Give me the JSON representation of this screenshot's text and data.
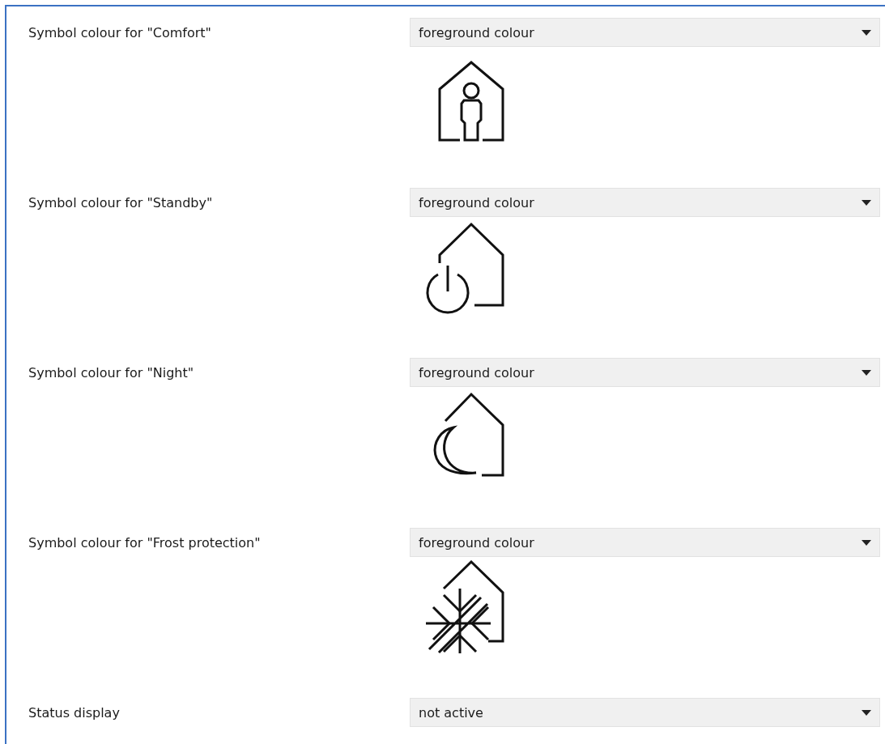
{
  "settings": [
    {
      "label": "Symbol colour for \"Comfort\"",
      "value": "foreground colour",
      "kind": "comfort"
    },
    {
      "label": "Symbol colour for \"Standby\"",
      "value": "foreground colour",
      "kind": "standby"
    },
    {
      "label": "Symbol colour for \"Night\"",
      "value": "foreground colour",
      "kind": "night"
    },
    {
      "label": "Symbol colour for \"Frost protection\"",
      "value": "foreground colour",
      "kind": "frost"
    },
    {
      "label": "Status display",
      "value": "not active"
    }
  ]
}
